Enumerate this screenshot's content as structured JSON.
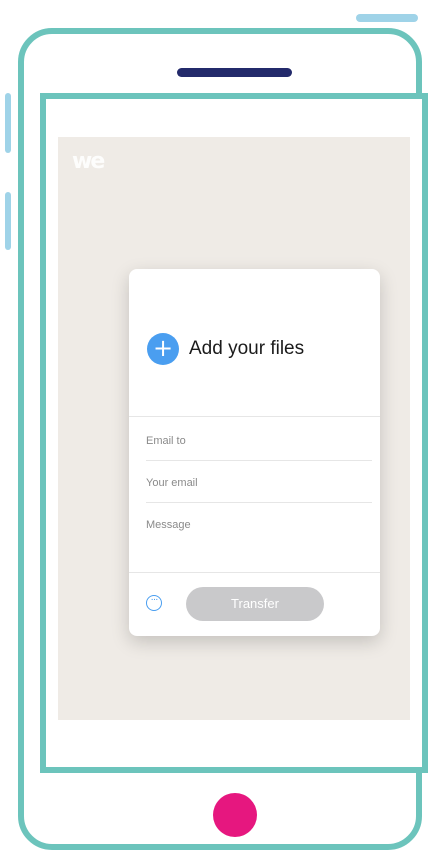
{
  "app": {
    "logo_text": "we"
  },
  "card": {
    "add_files_label": "Add your files",
    "plus_symbol": "+",
    "email_to_placeholder": "Email to",
    "your_email_placeholder": "Your email",
    "message_placeholder": "Message",
    "more_symbol": "···",
    "transfer_label": "Transfer"
  },
  "colors": {
    "frame": "#6cc4bc",
    "accent_blue": "#4a9ef0",
    "home_button": "#e6177f",
    "speaker": "#232a6b",
    "app_background": "#efebe6",
    "transfer_disabled": "#c9c9cb"
  },
  "icons": {
    "add": "plus-icon",
    "more": "more-options-icon"
  }
}
